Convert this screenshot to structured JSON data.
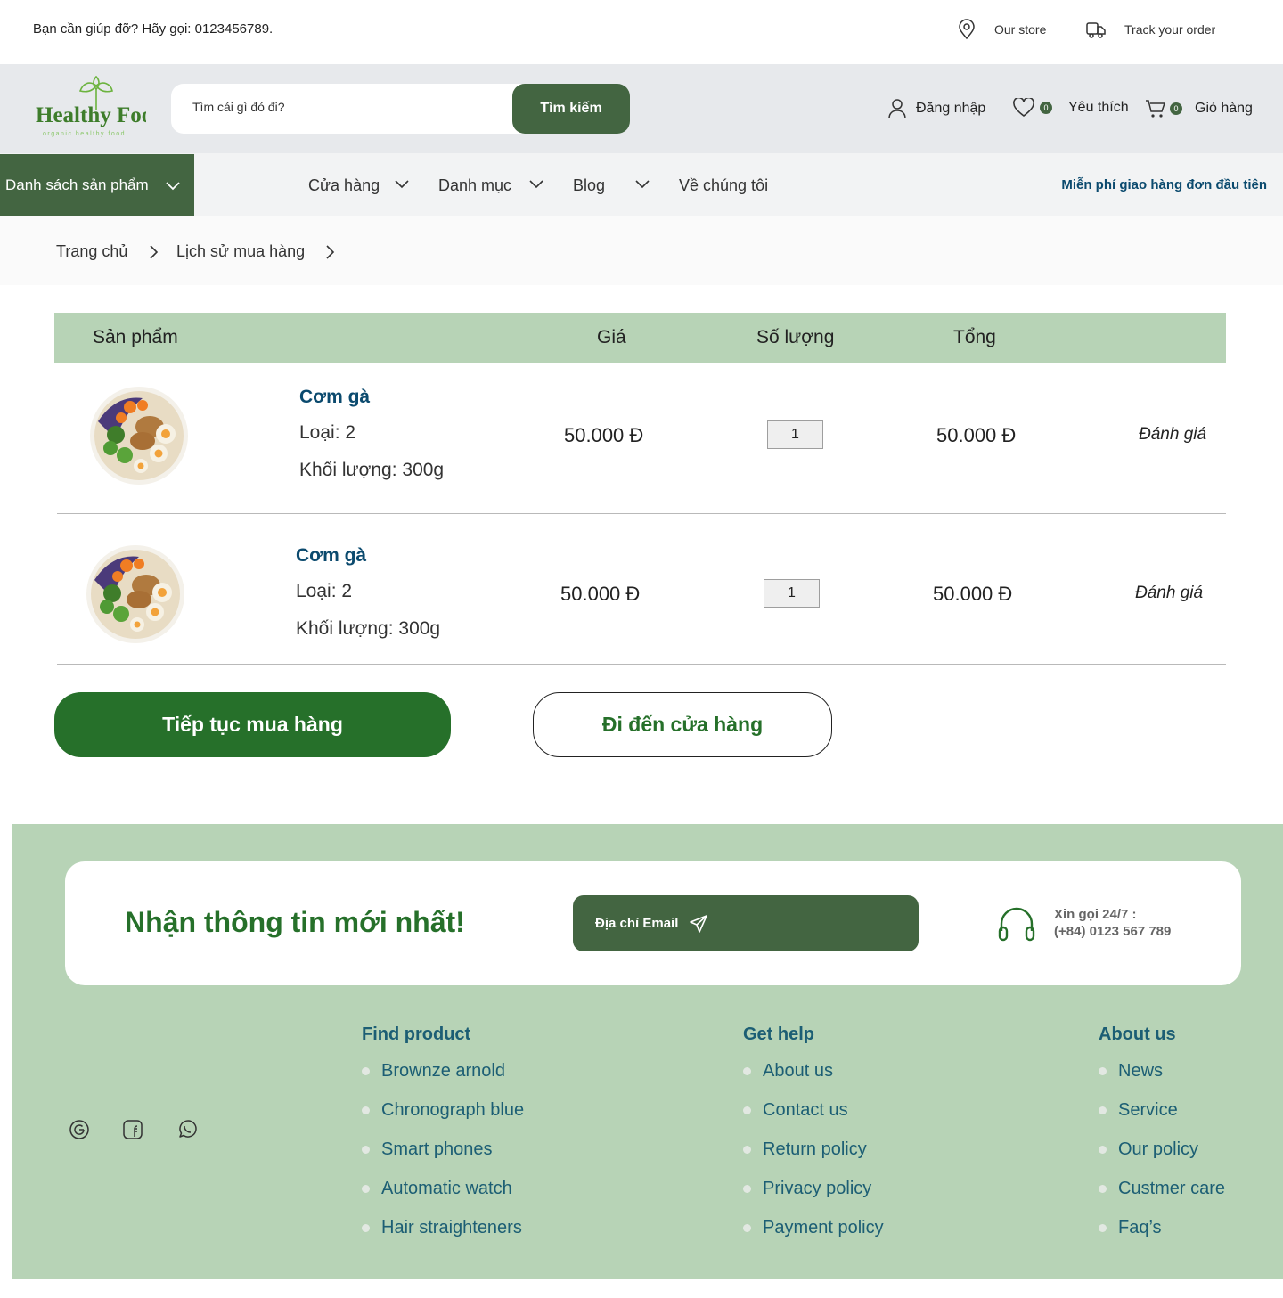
{
  "topbar": {
    "help_text": "Bạn cần giúp đỡ? Hãy gọi: 0123456789.",
    "store_label": "Our store",
    "track_label": "Track your order"
  },
  "header": {
    "logo_text": "Healthy Food",
    "logo_tagline": "organic healthy food",
    "search_placeholder": "Tìm cái gì đó đi?",
    "search_button": "Tìm kiếm",
    "login_label": "Đăng nhập",
    "wishlist_count": "0",
    "wishlist_label": "Yêu thích",
    "cart_count": "0",
    "cart_label": "Giỏ hàng"
  },
  "nav": {
    "category_button": "Danh sách sản phẩm",
    "items": [
      "Cửa hàng",
      "Danh mục",
      "Blog",
      "Về chúng tôi"
    ],
    "free_shipping": "Miễn phí giao hàng đơn đầu tiên"
  },
  "breadcrumb": [
    "Trang chủ",
    "Lịch sử mua hàng"
  ],
  "table": {
    "headers": [
      "Sản phẩm",
      "Giá",
      "Số lượng",
      "Tổng"
    ],
    "rows": [
      {
        "name": "Cơm gà",
        "type": "Loại: 2",
        "weight": "Khối lượng: 300g",
        "price": "50.000 Đ",
        "qty": "1",
        "total": "50.000 Đ",
        "review": "Đánh giá"
      },
      {
        "name": "Cơm gà",
        "type": "Loại: 2",
        "weight": "Khối lượng: 300g",
        "price": "50.000 Đ",
        "qty": "1",
        "total": "50.000 Đ",
        "review": "Đánh giá"
      }
    ]
  },
  "actions": {
    "continue": "Tiếp tục mua hàng",
    "go_store": "Đi đến cửa hàng"
  },
  "footer": {
    "newsletter_title": "Nhận thông tin mới nhất!",
    "email_label": "Địa chỉ Email",
    "phone_label": "Xin gọi 24/7 :",
    "phone_number": "(+84) 0123 567 789",
    "columns": [
      {
        "title": "Find product",
        "links": [
          "Brownze arnold",
          "Chronograph blue",
          "Smart phones",
          "Automatic watch",
          "Hair straighteners"
        ]
      },
      {
        "title": "Get help",
        "links": [
          "About us",
          "Contact us",
          "Return policy",
          "Privacy policy",
          "Payment policy"
        ]
      },
      {
        "title": "About us",
        "links": [
          "News",
          "Service",
          "Our policy",
          "Custmer care",
          "Faq’s"
        ]
      }
    ]
  },
  "colors": {
    "brand_green": "#436541",
    "accent_green": "#26702a",
    "light_green": "#b7d3b6",
    "link_blue": "#1c5e74"
  }
}
